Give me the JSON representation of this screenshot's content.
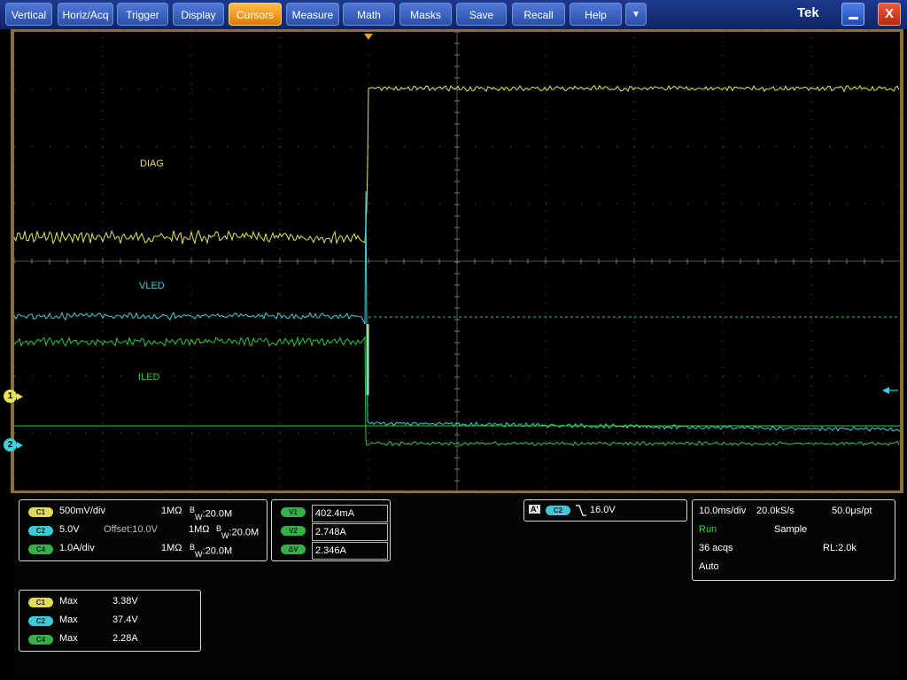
{
  "menu": {
    "items": [
      "Vertical",
      "Horiz/Acq",
      "Trigger",
      "Display",
      "Cursors",
      "Measure",
      "Math",
      "Masks",
      "Save",
      "Recall",
      "Help"
    ],
    "active": "Cursors",
    "dropdown_glyph": "▼",
    "brand": "Tek",
    "close_glyph": "X"
  },
  "graticule": {
    "trace_labels": {
      "diag": "DIAG",
      "vled": "VLED",
      "iled": "ILED"
    },
    "markers": {
      "ch1": "1",
      "ch2": "2"
    }
  },
  "channels": [
    {
      "pill": "C1",
      "scale": "500mV/div",
      "offset": "",
      "impedance": "1MΩ",
      "bw_sup": "B",
      "bw_sub": "W",
      "bw": ":20.0M"
    },
    {
      "pill": "C2",
      "scale": "5.0V",
      "offset": "Offset:10.0V",
      "impedance": "1MΩ",
      "bw_sup": "B",
      "bw_sub": "W",
      "bw": ":20.0M"
    },
    {
      "pill": "C4",
      "scale": "1.0A/div",
      "offset": "",
      "impedance": "1MΩ",
      "bw_sup": "B",
      "bw_sub": "W",
      "bw": ":20.0M"
    }
  ],
  "cursors": [
    {
      "pill": "V1",
      "value": "402.4mA"
    },
    {
      "pill": "V2",
      "value": "2.748A"
    },
    {
      "pill": "ΔV",
      "value": "2.346A"
    }
  ],
  "trigger": {
    "mode_badge": "A'",
    "source": "C2",
    "level": "16.0V"
  },
  "horizontal": {
    "scale": "10.0ms/div",
    "sample_rate": "20.0kS/s",
    "per_point": "50.0μs/pt",
    "state": "Run",
    "acq_mode": "Sample",
    "acqs": "36 acqs",
    "record_length": "RL:2.0k",
    "trigger_mode": "Auto"
  },
  "measurements": [
    {
      "pill": "C1",
      "label": "Max",
      "value": "3.38V"
    },
    {
      "pill": "C2",
      "label": "Max",
      "value": "37.4V"
    },
    {
      "pill": "C4",
      "label": "Max",
      "value": "2.28A"
    }
  ],
  "colors": {
    "ch1": "#e8e45a",
    "ch2": "#3ed0dc",
    "ch4": "#2ecc40",
    "grid": "#666666",
    "frame": "#8a7034",
    "run": "#33dd33",
    "menu": "#2c4fa8",
    "menu_active": "#f0a020"
  }
}
